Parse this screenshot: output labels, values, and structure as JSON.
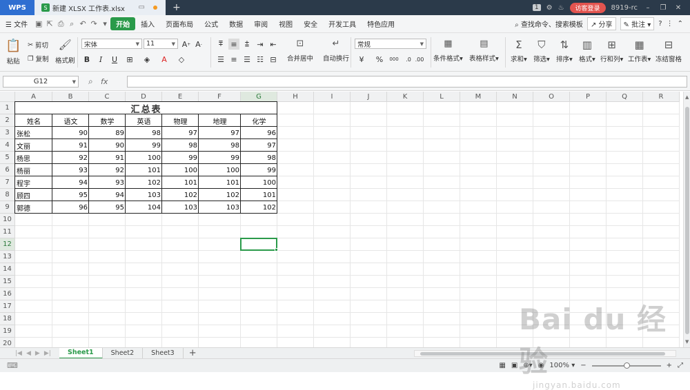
{
  "titlebar": {
    "app_tab": "WPS",
    "doc_tab": "新建 XLSX 工作表.xlsx",
    "doc_badge": "S",
    "page_count": "1",
    "visitor_login": "访客登录",
    "user_id": "8919-rc"
  },
  "menubar": {
    "file": "文件",
    "tabs": [
      "开始",
      "插入",
      "页面布局",
      "公式",
      "数据",
      "审阅",
      "视图",
      "安全",
      "开发工具",
      "特色应用"
    ],
    "search": "查找命令、搜索模板",
    "share": "分享",
    "comment": "批注"
  },
  "ribbon": {
    "paste": "粘贴",
    "cut": "剪切",
    "copy": "复制",
    "format_painter": "格式刷",
    "font_name": "宋体",
    "font_size": "11",
    "bold": "B",
    "italic": "I",
    "underline": "U",
    "merge_center": "合并居中",
    "wrap_text": "自动换行",
    "number_format": "常规",
    "percent": "%",
    "thousands": "000",
    "cond_format": "条件格式",
    "table_style": "表格样式",
    "sum": "求和",
    "filter": "筛选",
    "sort": "排序",
    "format": "格式",
    "rows_cols": "行和列",
    "worksheet": "工作表",
    "freeze": "冻结窗格"
  },
  "formulabar": {
    "name_box": "G12",
    "fx": "fx",
    "formula": ""
  },
  "grid": {
    "columns": [
      "A",
      "B",
      "C",
      "D",
      "E",
      "F",
      "G",
      "H",
      "I",
      "J",
      "K",
      "L",
      "M",
      "N",
      "O",
      "P",
      "Q",
      "R"
    ],
    "rows": [
      "1",
      "2",
      "3",
      "4",
      "5",
      "6",
      "7",
      "8",
      "9",
      "10",
      "11",
      "12",
      "13",
      "14",
      "15",
      "16",
      "17",
      "18",
      "19",
      "20"
    ],
    "selected_cell": "G12",
    "title": "汇总表",
    "headers": [
      "姓名",
      "语文",
      "数学",
      "英语",
      "物理",
      "地理",
      "化学"
    ],
    "data": [
      [
        "张松",
        "90",
        "89",
        "98",
        "97",
        "97",
        "96"
      ],
      [
        "文丽",
        "91",
        "90",
        "99",
        "98",
        "98",
        "97"
      ],
      [
        "杨思",
        "92",
        "91",
        "100",
        "99",
        "99",
        "98"
      ],
      [
        "杨丽",
        "93",
        "92",
        "101",
        "100",
        "100",
        "99"
      ],
      [
        "程宇",
        "94",
        "93",
        "102",
        "101",
        "101",
        "100"
      ],
      [
        "顾四",
        "95",
        "94",
        "103",
        "102",
        "102",
        "101"
      ],
      [
        "郭德",
        "96",
        "95",
        "104",
        "103",
        "103",
        "102"
      ]
    ]
  },
  "sheets": [
    "Sheet1",
    "Sheet2",
    "Sheet3"
  ],
  "active_sheet": "Sheet1",
  "status": {
    "zoom": "100%"
  },
  "watermark": {
    "brand": "Bai du 经验",
    "url": "jingyan.baidu.com"
  },
  "colors": {
    "accent_green": "#2a9a4a",
    "titlebar_bg": "#2b3a4a",
    "wps_blue": "#2f6fd1",
    "visitor_red": "#e3544f"
  }
}
